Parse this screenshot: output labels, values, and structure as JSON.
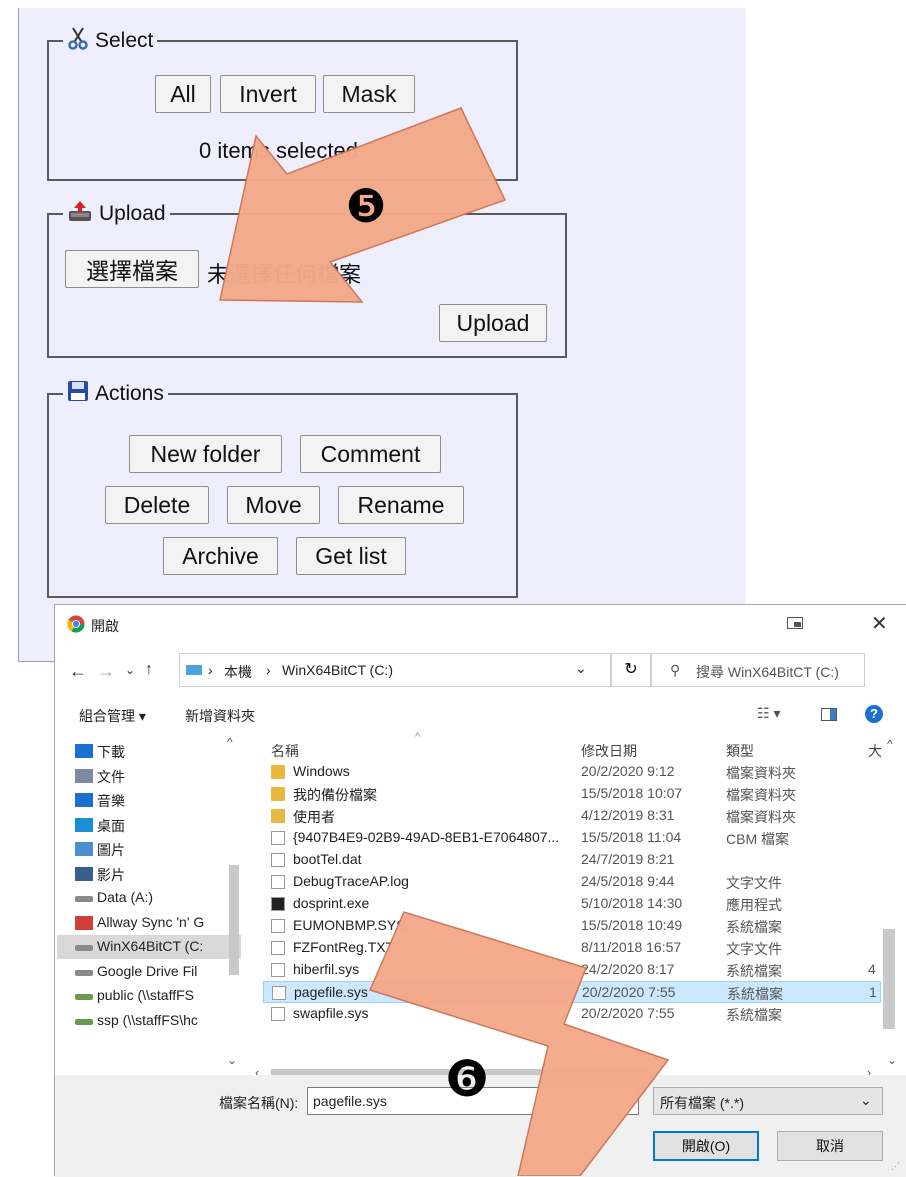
{
  "web": {
    "select": {
      "legend": "Select",
      "icon": "scissors-icon",
      "buttons": [
        "All",
        "Invert",
        "Mask"
      ],
      "status": "0 items selected"
    },
    "upload": {
      "legend": "Upload",
      "icon": "upload-icon",
      "choose_button": "選擇檔案",
      "no_file_text": "未選擇任何檔案",
      "upload_button": "Upload"
    },
    "actions": {
      "legend": "Actions",
      "icon": "save-icon",
      "row1": [
        "New folder",
        "Comment"
      ],
      "row2": [
        "Delete",
        "Move",
        "Rename"
      ],
      "row3": [
        "Archive",
        "Get list"
      ]
    }
  },
  "annotations": {
    "step5": "❺",
    "step6": "❻",
    "arrow_color": "#f4a98b"
  },
  "dialog": {
    "title": "開啟",
    "breadcrumb": [
      "本機",
      "WinX64BitCT (C:)"
    ],
    "search_placeholder": "搜尋 WinX64BitCT (C:)",
    "toolbar": {
      "organize": "組合管理 ▾",
      "new_folder": "新增資料夾"
    },
    "nav": [
      {
        "label": "下載",
        "icon": "download-icon"
      },
      {
        "label": "文件",
        "icon": "document-icon"
      },
      {
        "label": "音樂",
        "icon": "music-icon"
      },
      {
        "label": "桌面",
        "icon": "desktop-icon"
      },
      {
        "label": "圖片",
        "icon": "picture-icon"
      },
      {
        "label": "影片",
        "icon": "video-icon"
      },
      {
        "label": "Data (A:)",
        "icon": "drive-icon"
      },
      {
        "label": "Allway Sync 'n' G",
        "icon": "sync-icon"
      },
      {
        "label": "WinX64BitCT (C:",
        "icon": "drive-icon"
      },
      {
        "label": "Google Drive Fil",
        "icon": "drive-icon"
      },
      {
        "label": "public (\\\\staffFS",
        "icon": "network-drive-icon"
      },
      {
        "label": "ssp (\\\\staffFS\\hc",
        "icon": "network-drive-icon"
      }
    ],
    "columns": {
      "name": "名稱",
      "date": "修改日期",
      "type": "類型",
      "size": "大"
    },
    "files": [
      {
        "name": "Windows",
        "date": "20/2/2020 9:12",
        "type": "檔案資料夾",
        "size": "",
        "icon": "folder-icon"
      },
      {
        "name": "我的備份檔案",
        "date": "15/5/2018 10:07",
        "type": "檔案資料夾",
        "size": "",
        "icon": "folder-icon"
      },
      {
        "name": "使用者",
        "date": "4/12/2019 8:31",
        "type": "檔案資料夾",
        "size": "",
        "icon": "folder-icon"
      },
      {
        "name": "{9407B4E9-02B9-49AD-8EB1-E7064807...",
        "date": "15/5/2018 11:04",
        "type": "CBM 檔案",
        "size": "",
        "icon": "file-icon"
      },
      {
        "name": "bootTel.dat",
        "date": "24/7/2019 8:21",
        "type": "",
        "size": "",
        "icon": "file-icon"
      },
      {
        "name": "DebugTraceAP.log",
        "date": "24/5/2018 9:44",
        "type": "文字文件",
        "size": "",
        "icon": "text-file-icon"
      },
      {
        "name": "dosprint.exe",
        "date": "5/10/2018 14:30",
        "type": "應用程式",
        "size": "",
        "icon": "exe-icon"
      },
      {
        "name": "EUMONBMP.SYS",
        "date": "15/5/2018 10:49",
        "type": "系統檔案",
        "size": "",
        "icon": "system-file-icon"
      },
      {
        "name": "FZFontReg.TXT",
        "date": "8/11/2018 16:57",
        "type": "文字文件",
        "size": "",
        "icon": "text-file-icon"
      },
      {
        "name": "hiberfil.sys",
        "date": "24/2/2020 8:17",
        "type": "系統檔案",
        "size": "4",
        "icon": "system-file-icon"
      },
      {
        "name": "pagefile.sys",
        "date": "20/2/2020 7:55",
        "type": "系統檔案",
        "size": "1",
        "icon": "system-file-icon",
        "selected": true
      },
      {
        "name": "swapfile.sys",
        "date": "20/2/2020 7:55",
        "type": "系統檔案",
        "size": "",
        "icon": "system-file-icon"
      }
    ],
    "filename_label": "檔案名稱(N):",
    "filename_value": "pagefile.sys",
    "filter_value": "所有檔案 (*.*)",
    "open_button": "開啟(O)",
    "cancel_button": "取消"
  }
}
